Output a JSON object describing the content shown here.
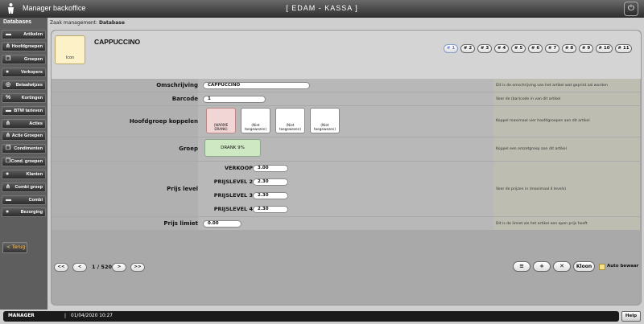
{
  "header": {
    "app_title": "Manager backoffice",
    "center_title": "[  EDAM  -  KASSA  ]",
    "power_icon": "power-icon"
  },
  "sidebar": {
    "heading": "Databases",
    "items": [
      {
        "label": "Artikelen",
        "icon": "card-icon"
      },
      {
        "label": "Hoofdgroepen",
        "icon": "tree-icon"
      },
      {
        "label": "Groepen",
        "icon": "layers-icon"
      },
      {
        "label": "Verkopers",
        "icon": "person-icon"
      },
      {
        "label": "Betaalwijzes",
        "icon": "coins-icon"
      },
      {
        "label": "Kortingen",
        "icon": "percent-icon"
      },
      {
        "label": "BTW tarieven",
        "icon": "card-icon"
      },
      {
        "label": "Acties",
        "icon": "tree-icon"
      },
      {
        "label": "Actie Groepen",
        "icon": "tree-icon"
      },
      {
        "label": "Condimenten",
        "icon": "layers-icon"
      },
      {
        "label": "Cond. groepen",
        "icon": "layers-icon"
      },
      {
        "label": "Klanten",
        "icon": "person-icon"
      },
      {
        "label": "Combi groep",
        "icon": "tree-icon"
      },
      {
        "label": "Combi",
        "icon": "card-icon"
      },
      {
        "label": "Bezorging",
        "icon": "person-icon"
      }
    ],
    "back_label": "< Terug"
  },
  "breadcrumb": {
    "prefix": "Zaak management: ",
    "current": "Database"
  },
  "article": {
    "icon_label": "Icon",
    "name": "CAPPUCCINO"
  },
  "pages": [
    "# 1",
    "# 2",
    "# 3",
    "# 4",
    "# 5",
    "# 6",
    "# 7",
    "# 8",
    "# 9",
    "# 10",
    "# 11"
  ],
  "fields": {
    "omschrijving": {
      "label": "Omschrijving",
      "value": "CAPPUCCINO",
      "help": "Dit is de omschrijving van het artikel wat geprint zal worden"
    },
    "barcode": {
      "label": "Barcode",
      "value": "1",
      "help": "Voer de (bar)code in van dit artikel"
    },
    "hoofdgroep": {
      "label": "Hoofdgroep koppelen",
      "help": "Koppel maximaal vier hoofdgroepen aan dit artikel",
      "boxes": [
        {
          "line1": "(WARME",
          "line2": "DRANK)"
        },
        {
          "line1": "(Niet",
          "line2": "toegewezen)"
        },
        {
          "line1": "(Niet",
          "line2": "toegewezen)"
        },
        {
          "line1": "(Niet",
          "line2": "toegewezen)"
        }
      ]
    },
    "groep": {
      "label": "Groep",
      "value": "DRANK 9%",
      "help": "Koppel een omzetgroep aan dit artikel"
    },
    "prijs": {
      "label": "Prijs level",
      "help": "Voer de prijzen in (maximaal 4 levels)",
      "levels": [
        {
          "name": "VERKOOP",
          "value": "3.00"
        },
        {
          "name": "PRIJSLEVEL 2",
          "value": "2.30"
        },
        {
          "name": "PRIJSLEVEL 3",
          "value": "2.30"
        },
        {
          "name": "PRIJSLEVEL 4",
          "value": "2.30"
        }
      ]
    },
    "limiet": {
      "label": "Prijs limiet",
      "value": "0.00",
      "help": "Dit is de limiet als het artikel een open prijs heeft"
    }
  },
  "pager": {
    "first": "<<",
    "prev": "<",
    "info": "1 / 520",
    "next": ">",
    "last": ">>"
  },
  "actions": {
    "menu": "≡",
    "add": "+",
    "delete": "✕",
    "clone": "Kloon",
    "auto_save": "Auto bewaar"
  },
  "status": {
    "user": "MANAGER",
    "separator": "|",
    "datetime": "01/04/2020 10:27",
    "help": "Help"
  }
}
